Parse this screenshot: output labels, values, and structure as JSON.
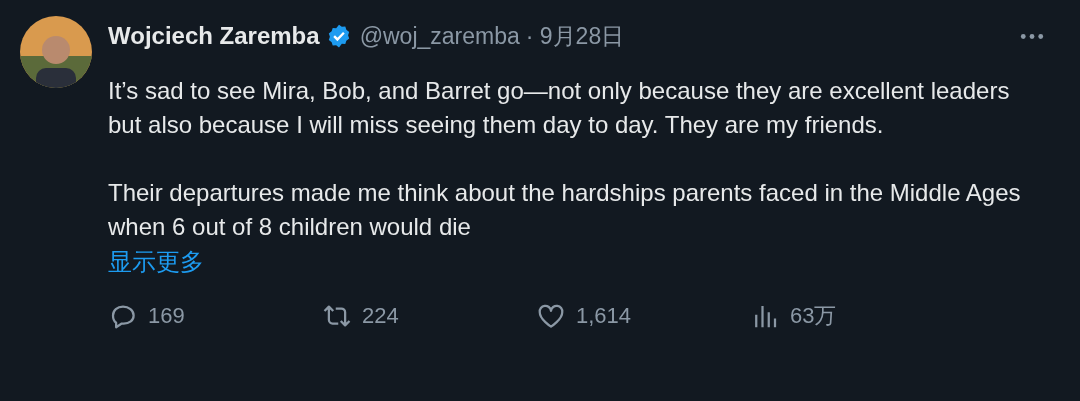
{
  "tweet": {
    "author": {
      "name": "Wojciech Zaremba",
      "verified": true,
      "handle": "@woj_zaremba",
      "date": "· 9月28日"
    },
    "paragraphs": [
      "It’s sad to see Mira, Bob, and Barret go—not only because they are excellent leaders but also because I will miss seeing them day to day. They are my friends.",
      "Their departures made me think about the hardships parents faced in the Middle Ages when 6 out of 8 children would die"
    ],
    "show_more": "显示更多",
    "actions": [
      {
        "kind": "reply",
        "count": "169"
      },
      {
        "kind": "retweet",
        "count": "224"
      },
      {
        "kind": "like",
        "count": "1,614"
      },
      {
        "kind": "views",
        "count": "63万"
      }
    ]
  }
}
